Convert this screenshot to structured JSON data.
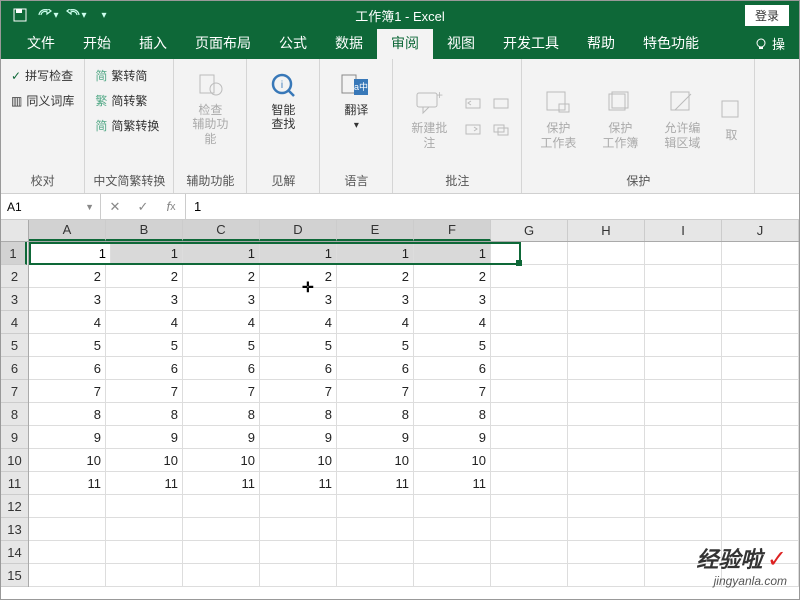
{
  "title": "工作簿1 - Excel",
  "login": "登录",
  "tabs": {
    "file": "文件",
    "home": "开始",
    "insert": "插入",
    "layout": "页面布局",
    "formula": "公式",
    "data": "数据",
    "review": "审阅",
    "view": "视图",
    "dev": "开发工具",
    "help": "帮助",
    "special": "特色功能",
    "tell_me": "操"
  },
  "ribbon": {
    "proofing": {
      "spell": "拼写检查",
      "thesaurus": "同义词库",
      "label": "校对"
    },
    "chinese": {
      "tc2sc": "繁转简",
      "sc2tc": "简转繁",
      "convert": "简繁转换",
      "label": "中文简繁转换"
    },
    "accessibility": {
      "check": "检查",
      "assist": "辅助功能",
      "label": "辅助功能"
    },
    "insights": {
      "smart": "智能",
      "lookup": "查找",
      "label": "见解"
    },
    "language": {
      "translate": "翻译",
      "label": "语言"
    },
    "comments": {
      "new": "新建批注",
      "label": "批注"
    },
    "protect": {
      "sheet": "保护",
      "sheet2": "工作表",
      "workbook": "保护",
      "workbook2": "工作簿",
      "allow": "允许编",
      "allow2": "辑区域",
      "share": "取",
      "label": "保护"
    }
  },
  "name_box": "A1",
  "formula_value": "1",
  "columns": [
    "A",
    "B",
    "C",
    "D",
    "E",
    "F",
    "G",
    "H",
    "I",
    "J"
  ],
  "rows": [
    "1",
    "2",
    "3",
    "4",
    "5",
    "6",
    "7",
    "8",
    "9",
    "10",
    "11",
    "12",
    "13",
    "14",
    "15"
  ],
  "selected_row": 0,
  "selected_cols": 6,
  "grid": [
    [
      "1",
      "1",
      "1",
      "1",
      "1",
      "1",
      "",
      "",
      "",
      ""
    ],
    [
      "2",
      "2",
      "2",
      "2",
      "2",
      "2",
      "",
      "",
      "",
      ""
    ],
    [
      "3",
      "3",
      "3",
      "3",
      "3",
      "3",
      "",
      "",
      "",
      ""
    ],
    [
      "4",
      "4",
      "4",
      "4",
      "4",
      "4",
      "",
      "",
      "",
      ""
    ],
    [
      "5",
      "5",
      "5",
      "5",
      "5",
      "5",
      "",
      "",
      "",
      ""
    ],
    [
      "6",
      "6",
      "6",
      "6",
      "6",
      "6",
      "",
      "",
      "",
      ""
    ],
    [
      "7",
      "7",
      "7",
      "7",
      "7",
      "7",
      "",
      "",
      "",
      ""
    ],
    [
      "8",
      "8",
      "8",
      "8",
      "8",
      "8",
      "",
      "",
      "",
      ""
    ],
    [
      "9",
      "9",
      "9",
      "9",
      "9",
      "9",
      "",
      "",
      "",
      ""
    ],
    [
      "10",
      "10",
      "10",
      "10",
      "10",
      "10",
      "",
      "",
      "",
      ""
    ],
    [
      "11",
      "11",
      "11",
      "11",
      "11",
      "11",
      "",
      "",
      "",
      ""
    ],
    [
      "",
      "",
      "",
      "",
      "",
      "",
      "",
      "",
      "",
      ""
    ],
    [
      "",
      "",
      "",
      "",
      "",
      "",
      "",
      "",
      "",
      ""
    ],
    [
      "",
      "",
      "",
      "",
      "",
      "",
      "",
      "",
      "",
      ""
    ],
    [
      "",
      "",
      "",
      "",
      "",
      "",
      "",
      "",
      "",
      ""
    ]
  ],
  "watermark": {
    "main": "经验啦",
    "sub": "jingyanla.com"
  }
}
